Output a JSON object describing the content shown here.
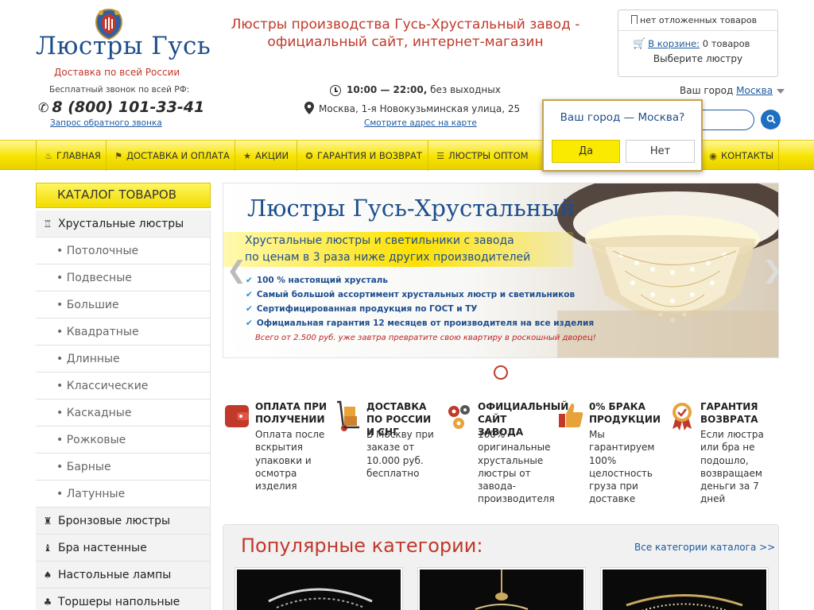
{
  "header": {
    "logo_text": "Люстры Гусь",
    "logo_subtitle": "Доставка по всей России",
    "free_call": "Бесплатный звонок по всей РФ:",
    "phone": "8 (800) 101-33-41",
    "callback_link": "Запрос обратного звонка",
    "headline_line1": "Люстры производства Гусь-Хрустальный завод -",
    "headline_line2": "официальный сайт, интернет-магазин",
    "hours_bold": "10:00 — 22:00,",
    "hours_rest": " без выходных",
    "address": "Москва, 1-я Новокузьминская улица, 25",
    "map_link": "Смотрите адрес на карте",
    "city_label": "Ваш город",
    "city_value": "Москва"
  },
  "cart": {
    "deferred": "нет отложенных товаров",
    "in_cart_link": "В корзине:",
    "in_cart_count": "0 товаров",
    "choose": "Выберите люстру"
  },
  "nav": {
    "items": [
      {
        "label": "ГЛАВНАЯ",
        "icon": "home-icon"
      },
      {
        "label": "ДОСТАВКА И ОПЛАТА",
        "icon": "flag-icon"
      },
      {
        "label": "АКЦИИ",
        "icon": "star-icon"
      },
      {
        "label": "ГАРАНТИЯ И ВОЗВРАТ",
        "icon": "medal-icon"
      },
      {
        "label": "ЛЮСТРЫ ОПТОМ",
        "icon": "stack-icon"
      },
      {
        "label": "КОНТАКТЫ",
        "icon": "contacts-icon"
      }
    ]
  },
  "city_popup": {
    "question": "Ваш город — Москва?",
    "yes": "Да",
    "no": "Нет"
  },
  "catalog": {
    "title": "КАТАЛОГ ТОВАРОВ",
    "items": [
      {
        "label": "Хрустальные люстры",
        "type": "main"
      },
      {
        "label": "• Потолочные",
        "type": "sub"
      },
      {
        "label": "• Подвесные",
        "type": "sub"
      },
      {
        "label": "• Большие",
        "type": "sub"
      },
      {
        "label": "• Квадратные",
        "type": "sub"
      },
      {
        "label": "• Длинные",
        "type": "sub"
      },
      {
        "label": "• Классические",
        "type": "sub"
      },
      {
        "label": "• Каскадные",
        "type": "sub"
      },
      {
        "label": "• Рожковые",
        "type": "sub"
      },
      {
        "label": "• Барные",
        "type": "sub"
      },
      {
        "label": "• Латунные",
        "type": "sub"
      },
      {
        "label": "Бронзовые люстры",
        "type": "main"
      },
      {
        "label": "Бра настенные",
        "type": "main"
      },
      {
        "label": "Настольные лампы",
        "type": "main"
      },
      {
        "label": "Торшеры напольные",
        "type": "main"
      }
    ]
  },
  "slider": {
    "title": "Люстры Гусь-Хрустальный",
    "subtitle1": "Хрустальные люстры и светильники с завода",
    "subtitle2": "по ценам в 3 раза ниже других производителей",
    "bullets": [
      "100 % настоящий хрусталь",
      "Самый большой ассортимент хрустальных люстр и светильников",
      "Сертифицированная продукция по ГОСТ и ТУ",
      "Официальная гарантия 12 месяцев от производителя на все изделия"
    ],
    "footer": "Всего от 2.500 руб. уже завтра превратите свою квартиру в роскошный дворец!"
  },
  "features": [
    {
      "title": "ОПЛАТА ПРИ ПОЛУЧЕНИИ",
      "text": "Оплата после вскрытия упаковки и осмотра изделия",
      "icon": "wallet-icon"
    },
    {
      "title": "ДОСТАВКА ПО РОССИИ И СНГ",
      "text": "В Москву при заказе от 10.000 руб. бесплатно",
      "icon": "hand-truck-icon"
    },
    {
      "title": "ОФИЦИАЛЬНЫЙ САЙТ ЗАВОДА",
      "text": "100% оригинальные хрустальные люстры от завода-производителя",
      "icon": "gears-icon"
    },
    {
      "title": "0% БРАКА ПРОДУКЦИИ",
      "text": "Мы гарантируем 100% целостность груза при доставке",
      "icon": "thumbs-up-icon"
    },
    {
      "title": "ГАРАНТИЯ ВОЗВРАТА",
      "text": "Если люстра или бра не подошло, возвращаем деньги за 7 дней",
      "icon": "badge-icon"
    }
  ],
  "popular": {
    "title": "Популярные категории:",
    "all_link": "Все категории каталога >>"
  },
  "colors": {
    "accent_yellow": "#f7e400",
    "brand_blue": "#1e4e8a",
    "brand_red": "#c0392b"
  }
}
